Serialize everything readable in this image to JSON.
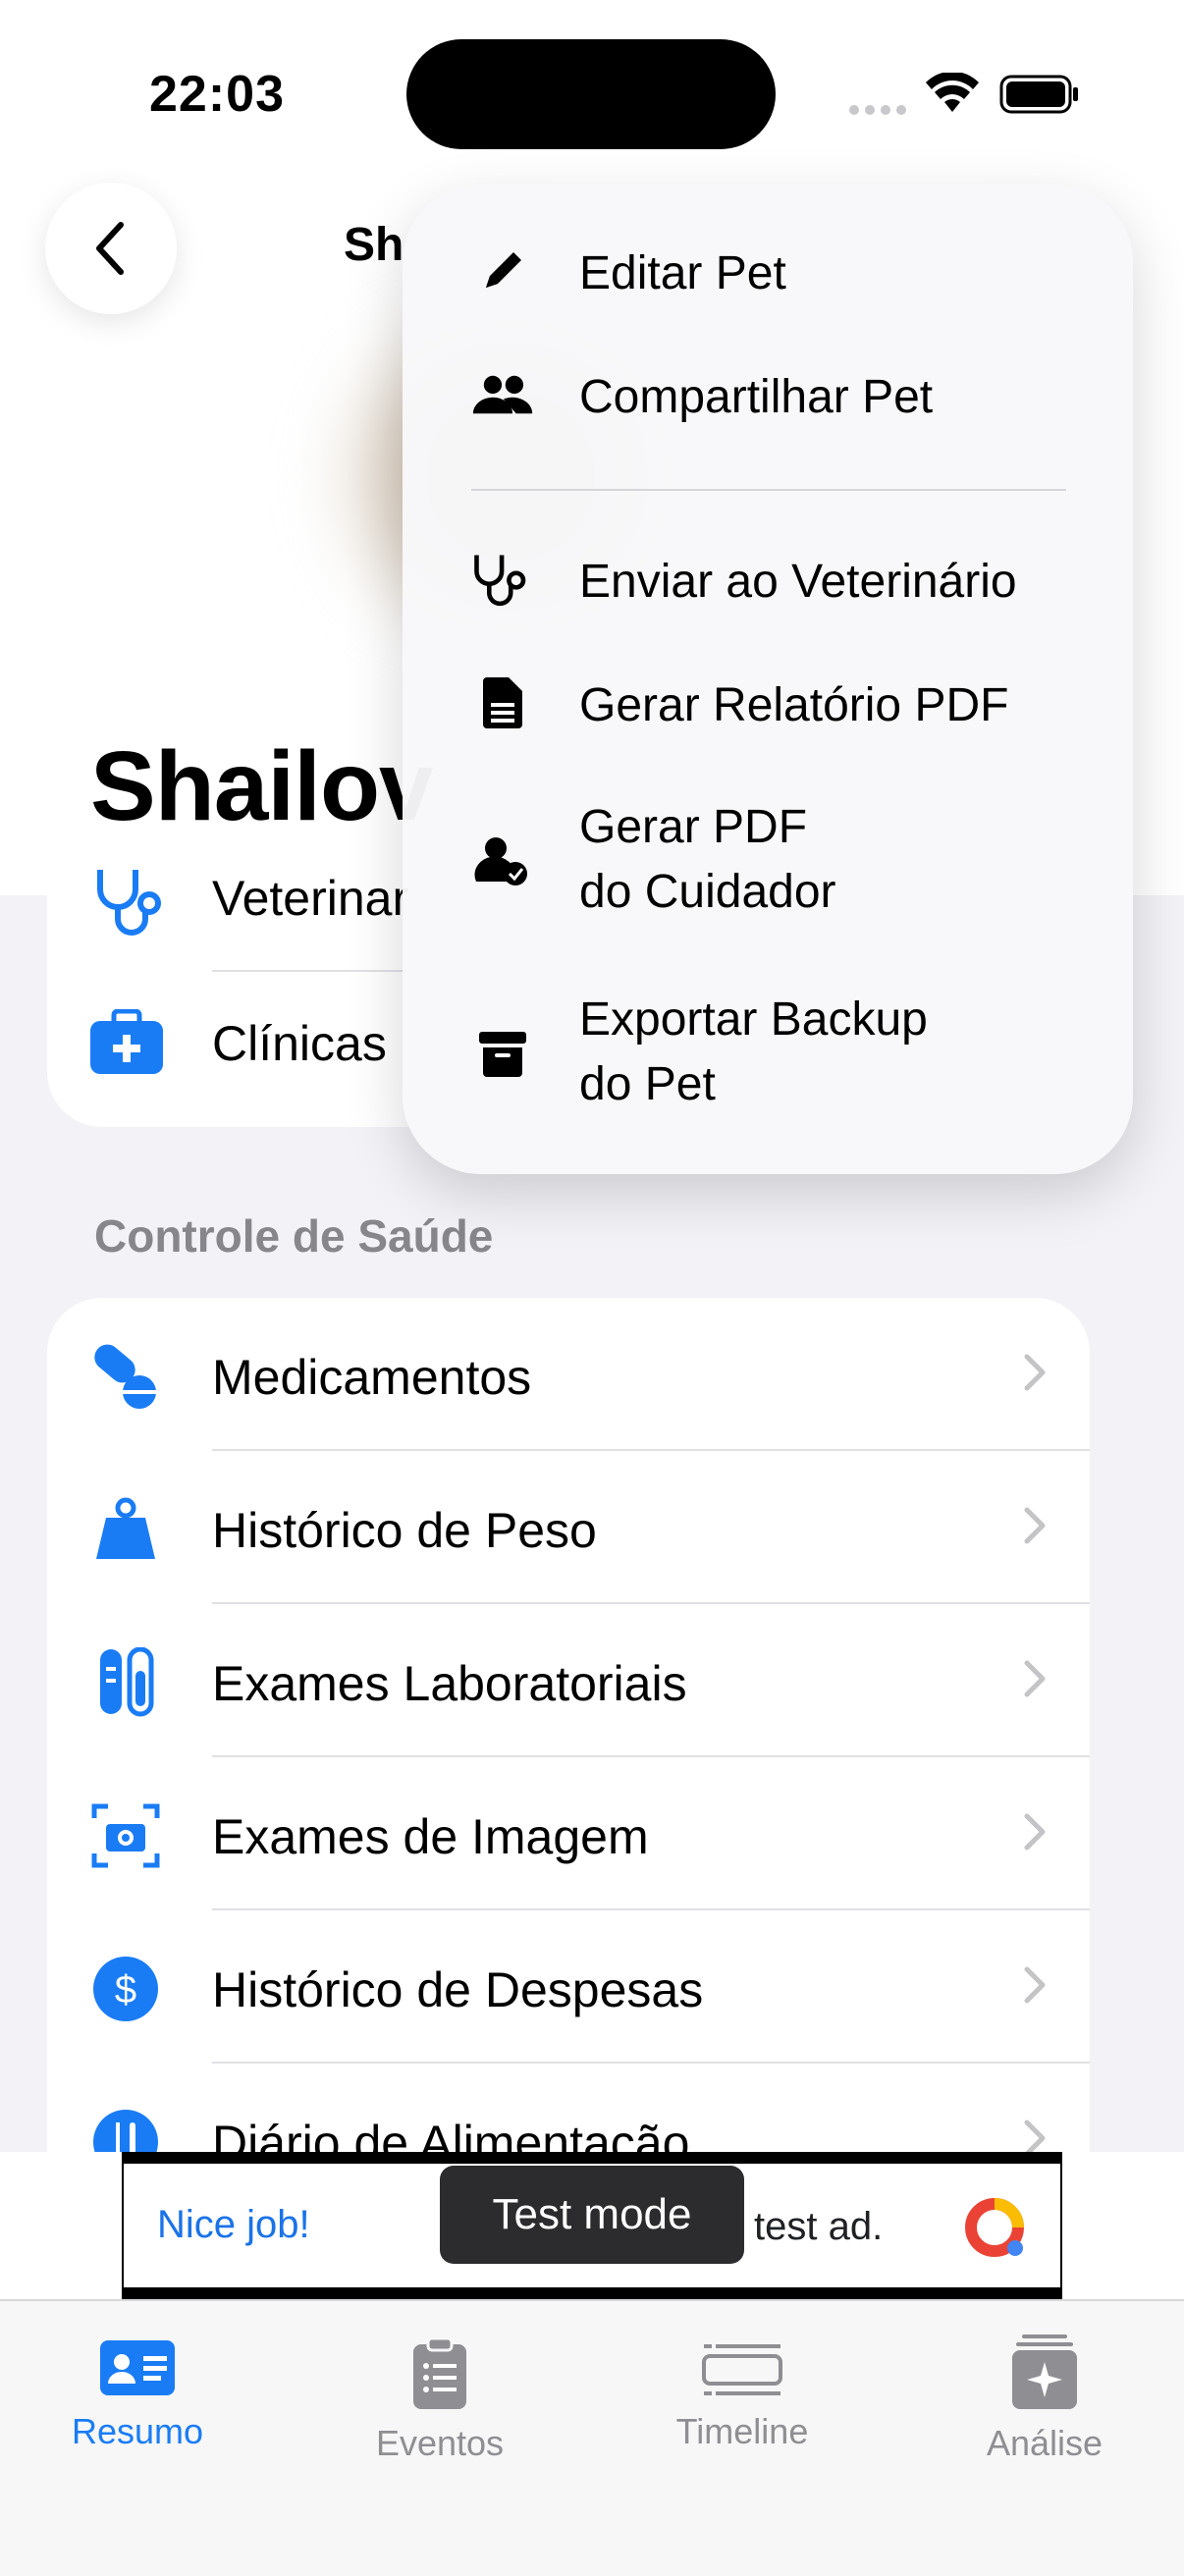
{
  "status": {
    "time": "22:03"
  },
  "header": {
    "title": "Sh",
    "pet_name": "Shailov"
  },
  "card1": {
    "rows": [
      {
        "label": "Veterinar"
      },
      {
        "label": "Clínicas"
      }
    ]
  },
  "health": {
    "section_title": "Controle de Saúde",
    "rows": [
      {
        "label": "Medicamentos",
        "icon": "pills-icon"
      },
      {
        "label": "Histórico de Peso",
        "icon": "weight-icon"
      },
      {
        "label": "Exames Laboratoriais",
        "icon": "test-tubes-icon"
      },
      {
        "label": "Exames de Imagem",
        "icon": "camera-icon"
      },
      {
        "label": "Histórico de Despesas",
        "icon": "dollar-icon"
      },
      {
        "label": "Diário de Alimentação",
        "icon": "fork-knife-icon"
      }
    ]
  },
  "menu": {
    "items": [
      {
        "label": "Editar Pet",
        "icon": "pencil-icon"
      },
      {
        "label": "Compartilhar Pet",
        "icon": "people-icon"
      },
      {
        "label": "Enviar ao Veterinário",
        "icon": "stethoscope-icon"
      },
      {
        "label": "Gerar Relatório PDF",
        "icon": "document-icon"
      },
      {
        "label_1": "Gerar PDF",
        "label_2": "do Cuidador",
        "icon": "person-badge-icon"
      },
      {
        "label_1": "Exportar Backup",
        "label_2": "do Pet",
        "icon": "archive-box-icon"
      }
    ]
  },
  "ad": {
    "nice": "Nice job!",
    "mode": "Test mode",
    "test": "test ad."
  },
  "tabs": [
    {
      "label": "Resumo",
      "icon": "person-card-icon",
      "active": true
    },
    {
      "label": "Eventos",
      "icon": "clipboard-list-icon",
      "active": false
    },
    {
      "label": "Timeline",
      "icon": "timeline-icon",
      "active": false
    },
    {
      "label": "Análise",
      "icon": "sparkle-analysis-icon",
      "active": false
    }
  ],
  "colors": {
    "accent": "#1a7cf5",
    "gray_label": "#86868b",
    "background": "#f2f2f7"
  }
}
